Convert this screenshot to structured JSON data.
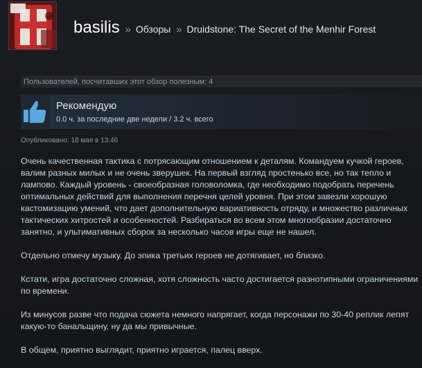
{
  "header": {
    "username": "basilis",
    "separator": "»",
    "crumb_reviews": "Обзоры",
    "crumb_game": "Druidstone: The Secret of the Menhir Forest"
  },
  "helpful": {
    "text": "Пользователей, посчитавших этот обзор полезным: 4"
  },
  "recommendation": {
    "title": "Рекомендую",
    "hours": "0.0 ч. за последние две недели / 3.2 ч. всего"
  },
  "posted": {
    "text": "Опубликовано: 18 мая в 13:46"
  },
  "review": {
    "paragraphs": [
      "Очень качественная тактика с потрясающим отношением к деталям. Командуем кучкой героев, валим разных милых и не очень зверушек. На первый взгляд простенько все, но так тепло и лампово. Каждый уровень - своеобразная головоломка, где необходимо подобрать перечень оптимальных действий для выполнения перечня целей уровня. При этом завезли хорошую кастомизацию умений, что дает дополнительную вариативность отряду, и множество различных тактических хитростей и особенностей. Разбираться во всем этом многообразии достаточно занятно, и ультимативных сборок за несколько часов игры еще не нашел.",
      "Отдельно отмечу музыку. До эпика третьих героев не дотягивает, но близко.",
      "Кстати, игра достаточно сложная, хотя сложность часто достигается разнотипными ограничениями по времени.",
      "Из минусов разве что подача сюжета немного напрягает, когда персонажи по 30-40 реплик лепят какую-то банальщину, ну да мы привычные.",
      "В общем, приятно выглядит, приятно играется, палец вверх."
    ]
  },
  "icons": {
    "avatar": "avatar-image",
    "thumb": "thumbs-up-icon"
  },
  "colors": {
    "background": "#16171c",
    "text": "#c6d4df",
    "thumb_blue": "#5ba8e0"
  }
}
